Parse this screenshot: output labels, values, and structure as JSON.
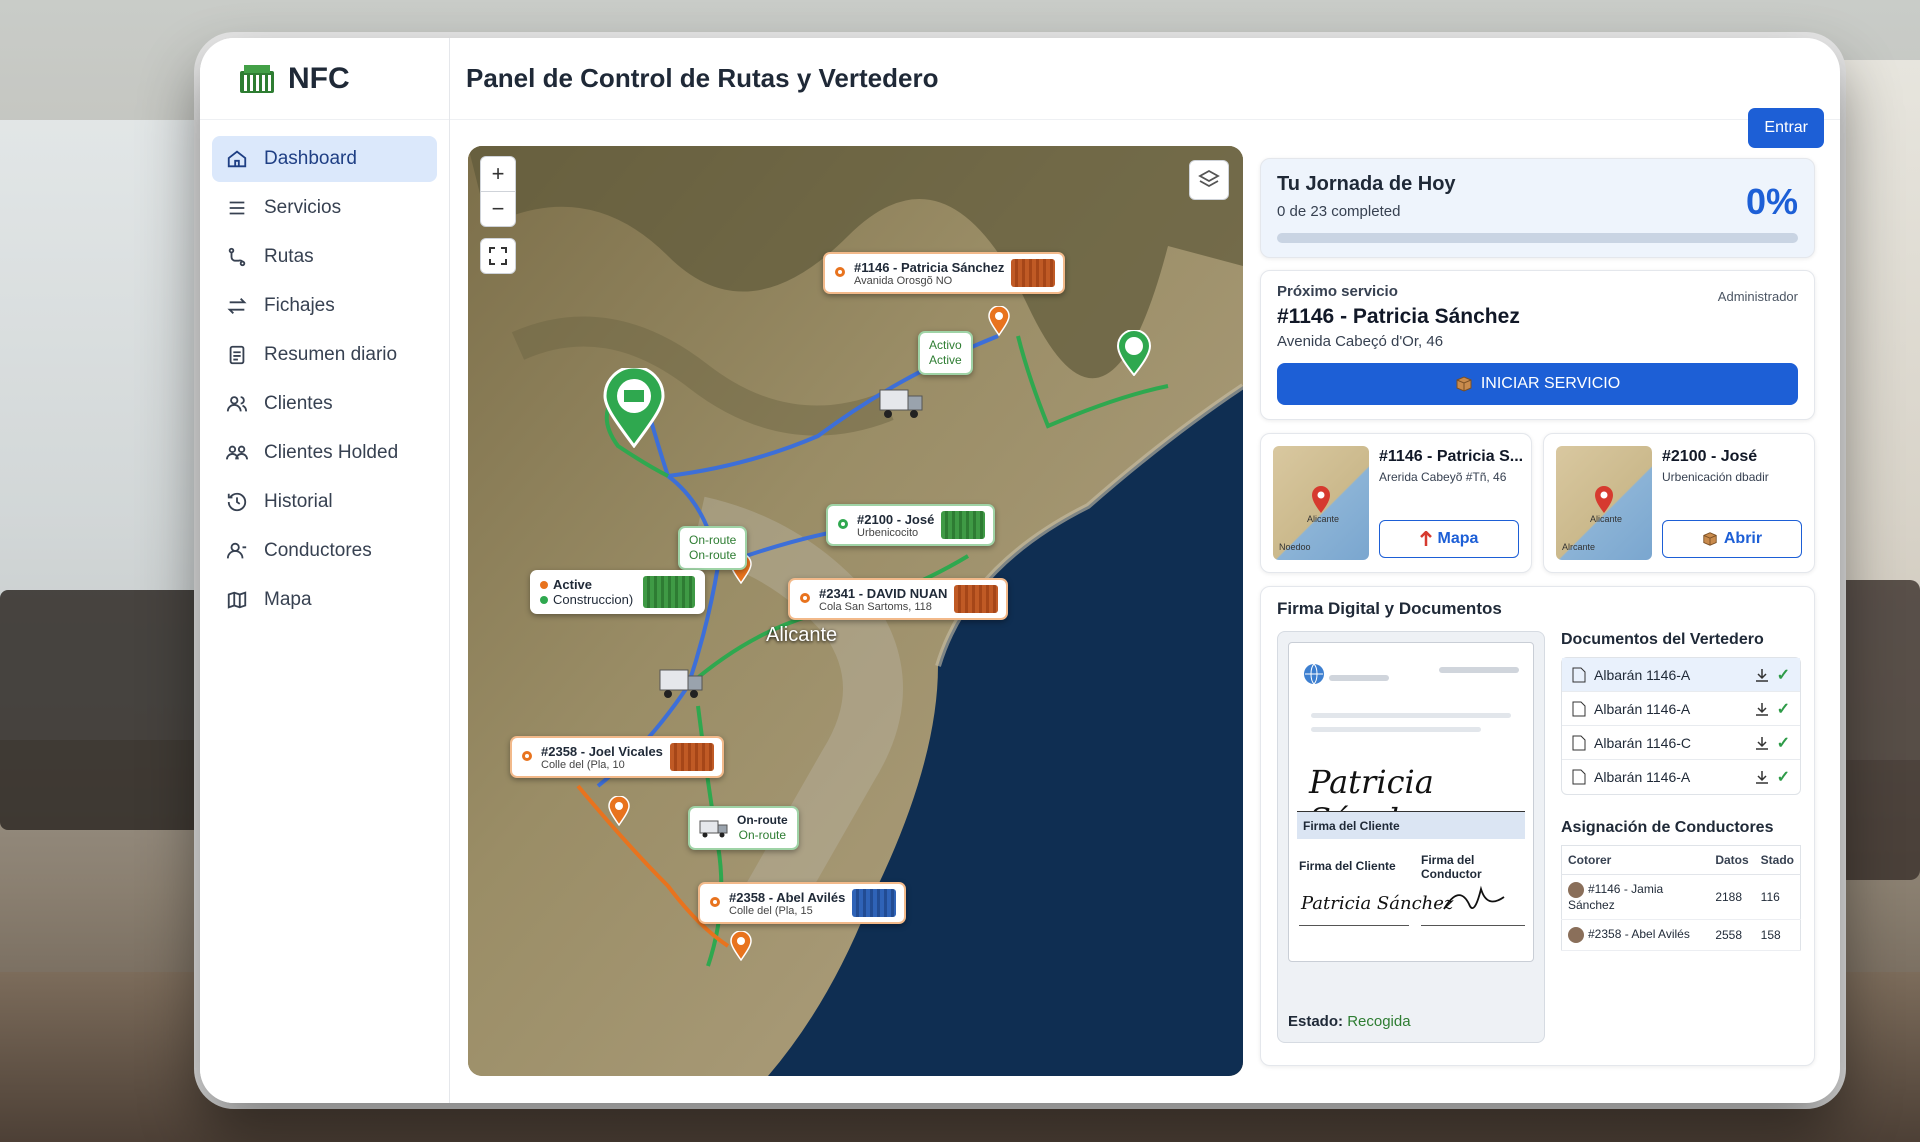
{
  "brand": {
    "name": "NFC"
  },
  "header": {
    "title": "Panel de Control de Rutas y Vertedero",
    "entrar_label": "Entrar"
  },
  "sidebar": {
    "items": [
      {
        "label": "Dashboard",
        "icon": "home-icon",
        "active": true
      },
      {
        "label": "Servicios",
        "icon": "layers-icon"
      },
      {
        "label": "Rutas",
        "icon": "route-icon"
      },
      {
        "label": "Fichajes",
        "icon": "swap-arrows-icon"
      },
      {
        "label": "Resumen diario",
        "icon": "document-icon"
      },
      {
        "label": "Clientes",
        "icon": "users-icon"
      },
      {
        "label": "Clientes Holded",
        "icon": "user-group-icon"
      },
      {
        "label": "Historial",
        "icon": "history-icon"
      },
      {
        "label": "Conductores",
        "icon": "driver-icon"
      },
      {
        "label": "Mapa",
        "icon": "map-icon"
      }
    ]
  },
  "map": {
    "city": "Alicante",
    "markers": [
      {
        "title": "#1146 - Patricia Sánchez",
        "sub": "Avanida Orosgõ NO"
      },
      {
        "title": "#2100 - José",
        "sub": "Urbenicocito"
      },
      {
        "title": "#2341 - DAVID NUAN",
        "sub": "Cola San Sartoms, 118"
      },
      {
        "title": "#2358 - Joel Vicales",
        "sub": "Colle del (Pla, 10"
      },
      {
        "title": "#2358 - Abel Avilés",
        "sub": "Colle del (Pla, 15"
      }
    ],
    "status_activo": {
      "a": "Activo",
      "b": "Active"
    },
    "status_onroute1": {
      "a": "On-route",
      "b": "On-route"
    },
    "status_onroute2": {
      "a": "On-route",
      "b": "On-route"
    },
    "legend": {
      "a": "Active",
      "b": "Construccion)"
    },
    "colors": {
      "orange": "#e8731e",
      "green": "#2fa84f",
      "blue": "#3d6fd8"
    }
  },
  "jornada": {
    "title": "Tu Jornada de Hoy",
    "subtitle": "0 de 23 completed",
    "percent_text": "0%",
    "progress": 0
  },
  "proximo": {
    "label": "Próximo servicio",
    "role": "Administrador",
    "name": "#1146 - Patricia Sánchez",
    "address": "Avenida Cabeçó d'Or, 46",
    "button": "INICIAR SERVICIO"
  },
  "service_cards": [
    {
      "name": "#1146 - Patricia S...",
      "address": "Arerida Cabeyõ #Tñ, 46",
      "map_label": "Alicante",
      "map_label2": "Noedoo",
      "button": "Mapa"
    },
    {
      "name": "#2100 - José",
      "address": "Urbenicación dbadir",
      "map_label": "Alicante",
      "map_label2": "Alrcante",
      "button": "Abrir"
    }
  ],
  "firma": {
    "title": "Firma Digital y Documentos",
    "signature_name": "Patricia Sánchez",
    "firma_cliente": "Firma del Cliente",
    "firma_cliente2": "Firma del Cliente",
    "firma_conductor": "Firma del Conductor",
    "estado_label": "Estado:",
    "estado_value": "Recogida"
  },
  "documentos": {
    "title": "Documentos del Vertedero",
    "items": [
      "Albarán 1146-A",
      "Albarán 1146-A",
      "Albarán 1146-C",
      "Albarán 1146-A"
    ]
  },
  "asignacion": {
    "title": "Asignación de Conductores",
    "headers": [
      "Cotorer",
      "Datos",
      "Stado"
    ],
    "rows": [
      {
        "name": "#1146 - Jamia Sánchez",
        "datos": "2188",
        "stado": "116"
      },
      {
        "name": "#2358 - Abel Avilés",
        "datos": "2558",
        "stado": "158"
      }
    ]
  }
}
